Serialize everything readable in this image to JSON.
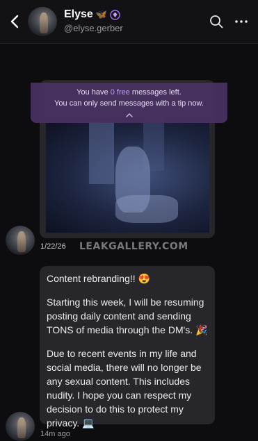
{
  "header": {
    "name": "Elyse",
    "name_badge_butterfly": "🦋",
    "username": "@elyse.gerber",
    "icons": [
      "back-chevron-icon",
      "search-icon",
      "more-icon",
      "verified-diamond-icon"
    ]
  },
  "banner": {
    "prefix": "You have ",
    "free_count": "0",
    "free_word": " free",
    "suffix": " messages left.",
    "line2": "You can only send messages with a tip now.",
    "accent_color": "#b9a3ff",
    "background": "#483262"
  },
  "messages": [
    {
      "type": "media",
      "timestamp": "1/22/26"
    },
    {
      "type": "text",
      "timestamp": "14m ago",
      "paragraphs": [
        "Content rebranding!! 😍",
        "Starting this week, I will be resuming posting daily content and sending TONS of media through the DM's. 🎉",
        "Due to recent events in my life and social media, there will no longer be any sexual content. This includes nudity. I hope you can respect my decision to do this to protect my privacy. 💻"
      ]
    }
  ],
  "watermark": "LEAKGALLERY.COM",
  "colors": {
    "background": "#0d0d0f",
    "bubble": "#26262b",
    "text": "#ececef",
    "muted": "#9a9aa2"
  }
}
